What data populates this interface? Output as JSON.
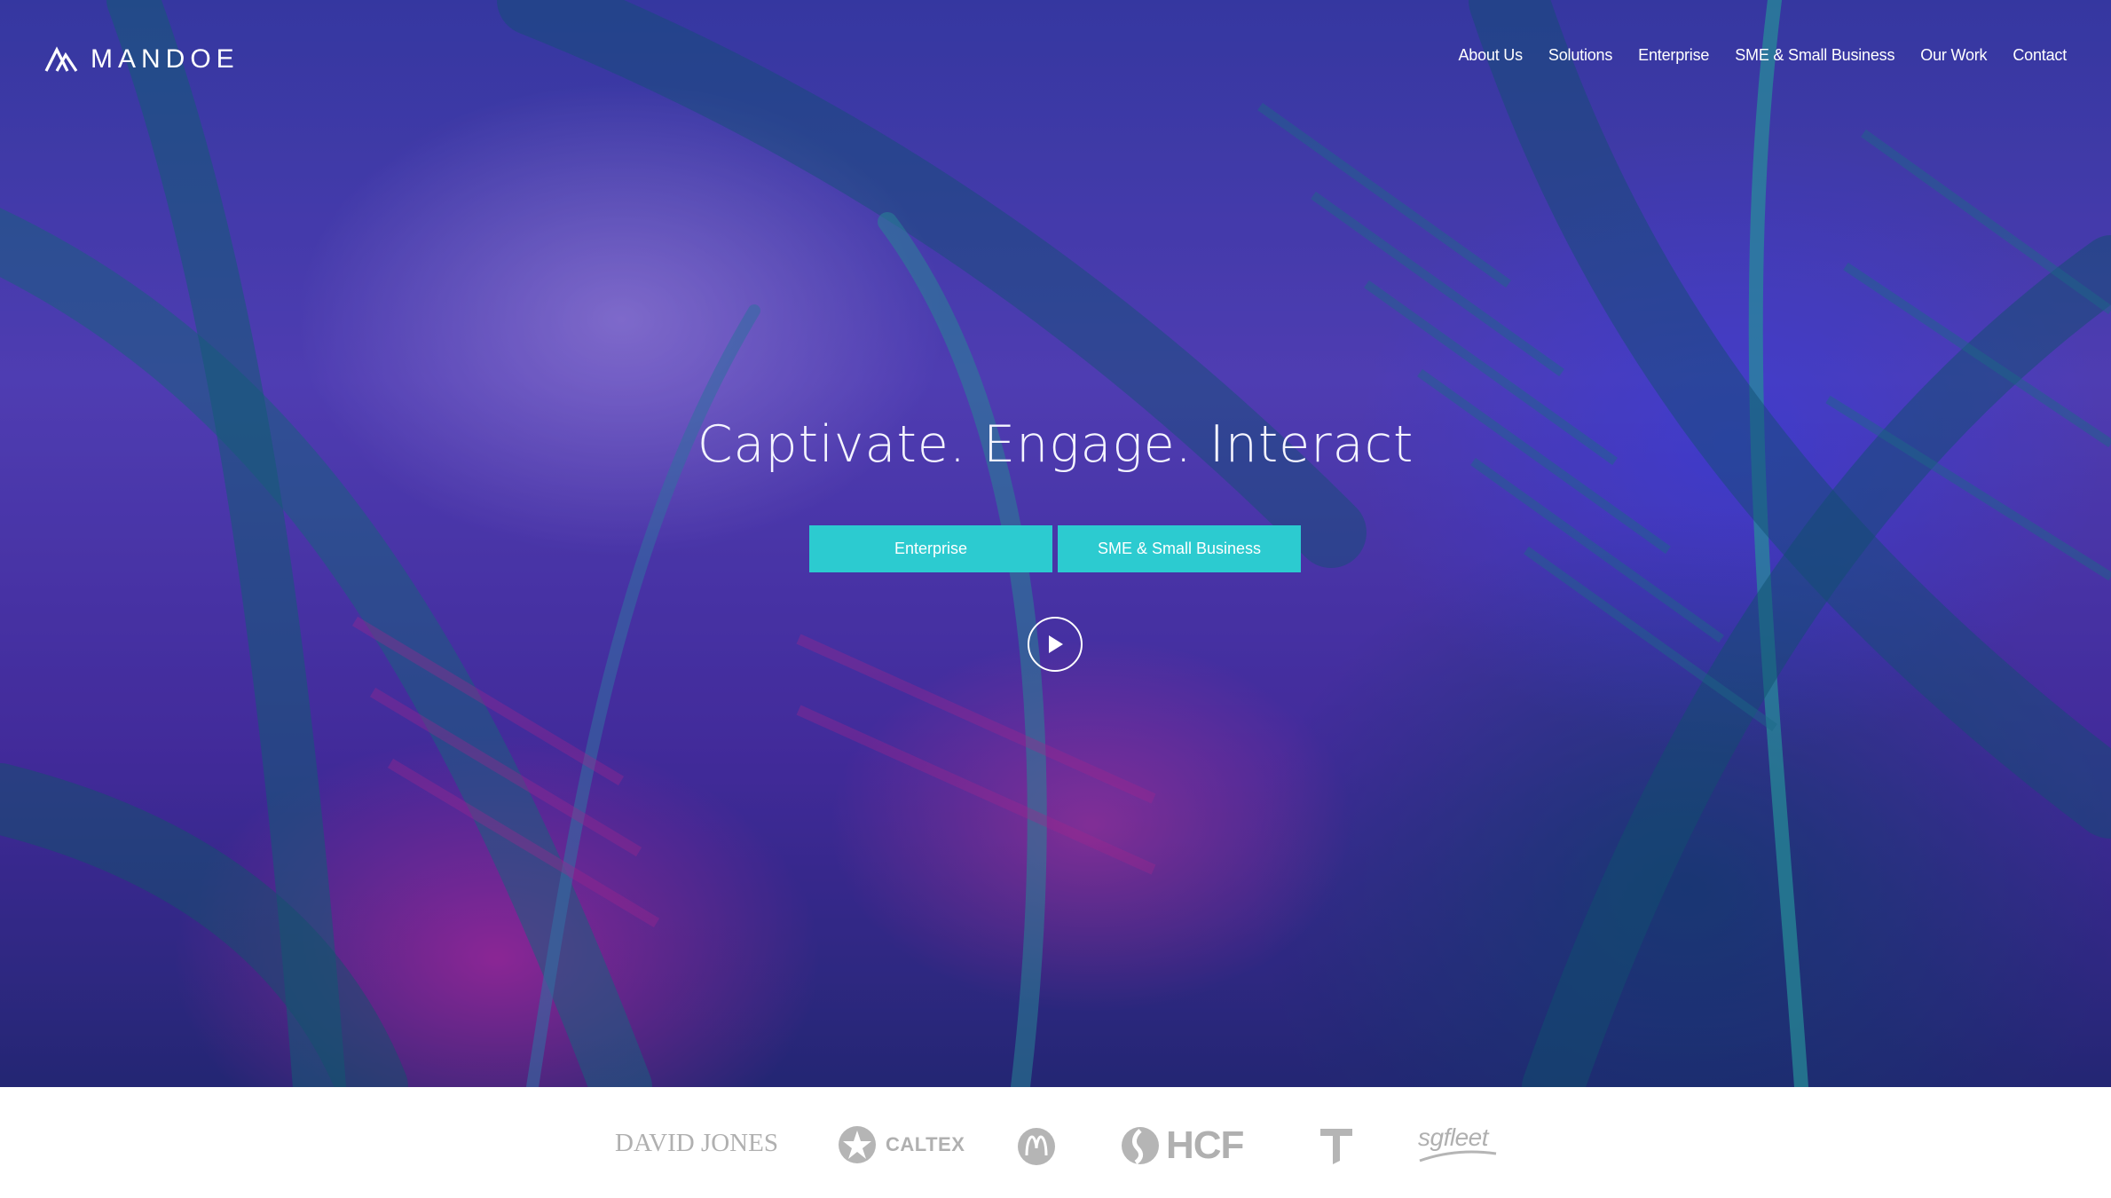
{
  "brand": {
    "name": "MANDOE"
  },
  "nav": {
    "items": [
      {
        "label": "About Us"
      },
      {
        "label": "Solutions"
      },
      {
        "label": "Enterprise"
      },
      {
        "label": "SME & Small Business"
      },
      {
        "label": "Our Work"
      },
      {
        "label": "Contact"
      }
    ]
  },
  "hero": {
    "headline": "Captivate. Engage. Interact",
    "buttons": [
      {
        "label": "Enterprise"
      },
      {
        "label": "SME & Small Business"
      }
    ],
    "play_icon": "play-icon",
    "accent_color": "#2ccbd0"
  },
  "clients": {
    "logos": [
      {
        "name": "DAVID JONES"
      },
      {
        "name": "CALTEX"
      },
      {
        "name": "McDonald's",
        "icon": "mcdonalds-icon"
      },
      {
        "name": "HCF"
      },
      {
        "name": "Telstra",
        "icon": "telstra-icon"
      },
      {
        "name": "sgfleet"
      }
    ]
  }
}
